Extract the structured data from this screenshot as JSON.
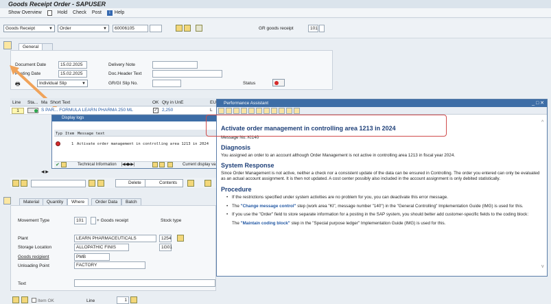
{
  "window_title": "Goods Receipt Order - SAPUSER",
  "menu": [
    "Show Overview",
    "Hold",
    "Check",
    "Post",
    "Help"
  ],
  "toolbar": {
    "action": "Goods Receipt",
    "ref_type": "Order",
    "order_no": "60006105",
    "gr_label": "GR goods receipt",
    "gr_value": "101"
  },
  "header_tabs": [
    "General",
    ""
  ],
  "general": {
    "doc_date_label": "Document Date",
    "doc_date": "15.02.2025",
    "post_date_label": "Posting Date",
    "post_date": "15.02.2025",
    "delivery_label": "Delivery Note",
    "doc_header_label": "Doc.Header Text",
    "slip_label": "GR/GI Slip No.",
    "slip_select": "Individual Slip",
    "status_label": "Status"
  },
  "item_table": {
    "headers": [
      "Line",
      "Sta...",
      "Ma",
      "Short Text",
      "OK",
      "Qty in UnE",
      "EU"
    ],
    "row": {
      "line": "1",
      "text": "S PAR... FORMULA LEARN PHARMA 250 ML",
      "qty": "2,250",
      "eu": "L"
    }
  },
  "log": {
    "title": "Display logs",
    "col_typ": "Typ",
    "col_item": "Item",
    "col_msg": "Message text",
    "row_item": "1",
    "row_msg": "Activate order management in controlling area 1213 in 2024",
    "btn_tech": "Technical Information",
    "btn_current": "Current display va"
  },
  "item_buttons": {
    "delete": "Delete",
    "contents": "Contents"
  },
  "detail_tabs": [
    "Material",
    "Quantity",
    "Where",
    "Order Data",
    "Batch"
  ],
  "detail": {
    "movement_label": "Movement Type",
    "movement_value": "101",
    "movement_text": "+ Goods receipt",
    "stock_label": "Stock type",
    "plant_label": "Plant",
    "plant_value": "LEARN PHARMACEUTICALS",
    "plant_code": "1254",
    "sloc_label": "Storage Location",
    "sloc_value": "ALLOPATHIC FINIS",
    "sloc_code": "1G01",
    "recipient_label": "Goods recipient",
    "recipient_value": "PMB",
    "unloading_label": "Unloading Point",
    "unloading_value": "FACTORY",
    "text_label": "Text"
  },
  "footer": {
    "item_ok": "Item OK",
    "line_label": "Line",
    "line_value": "1"
  },
  "assistant": {
    "title": "Performance Assistant",
    "heading": "Activate order management in controlling area 1213 in 2024",
    "message_no": "Message No. KI140",
    "diagnosis_title": "Diagnosis",
    "diagnosis": "You assigned an order to an account although Order Management is not active in controlling area 1213 in fiscal year 2024.",
    "response_title": "System Response",
    "response": "Since Order Management is not active, neither a check nor a consistent update of the data can be ensured in Controlling. The order you entered can only be evaluated as an actual account assignment. It is then not updated. A cost center possibly also included in the account assignment is only debited statistically.",
    "procedure_title": "Procedure",
    "p1": "If the restrictions specified under system activities are no problem for you, you can deactivate this error message.",
    "p2_pre": "The ",
    "p2_link": "\"Change message control\"",
    "p2_post": " step (work area \"KI\", message number \"140\") in the \"General Controlling\" Implementation Guide (IMG) is used for this.",
    "p3": "If you use the \"Order\" field to store separate information for a posting in the SAP system, you should better add customer-specific fields to the coding block:",
    "p4_pre": "The ",
    "p4_link": "\"Maintain coding block\"",
    "p4_post": " step in the \"Special purpose ledger\" Implementation Guide (IMG) is used for this."
  }
}
